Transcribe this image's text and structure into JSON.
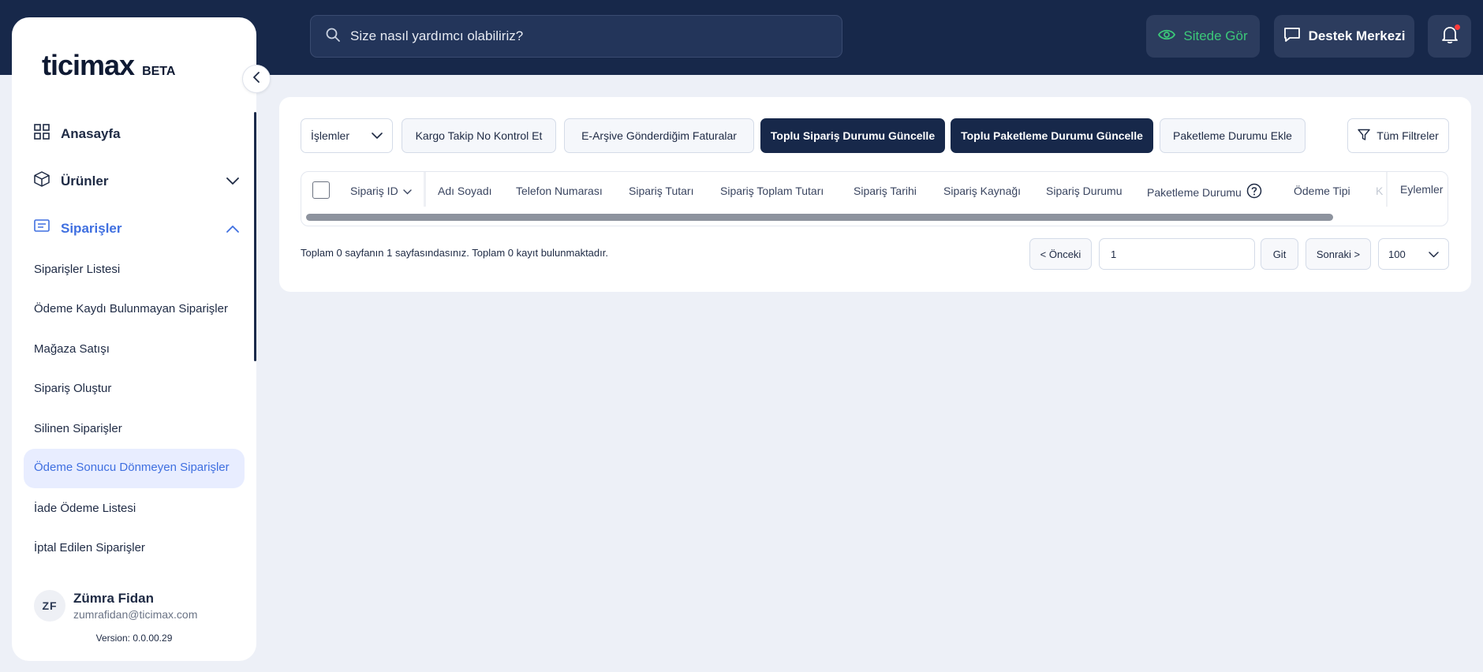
{
  "header": {
    "search_placeholder": "Size nasıl yardımcı olabiliriz?",
    "site_button": "Sitede Gör",
    "support_button": "Destek Merkezi"
  },
  "sidebar": {
    "logo_text": "ticimax",
    "logo_badge": "BETA",
    "nav": [
      {
        "label": "Anasayfa",
        "icon": "grid-icon"
      },
      {
        "label": "Ürünler",
        "icon": "box-icon"
      },
      {
        "label": "Siparişler",
        "icon": "receipt-icon"
      }
    ],
    "sub_items": [
      "Siparişler Listesi",
      "Ödeme Kaydı Bulunmayan Siparişler",
      "Mağaza Satışı",
      "Sipariş Oluştur",
      "Silinen Siparişler",
      "Ödeme Sonucu Dönmeyen Siparişler",
      "İade Ödeme Listesi",
      "İptal Edilen Siparişler"
    ],
    "selected_sub_item": "Ödeme Sonucu Dönmeyen Siparişler",
    "user": {
      "initials": "ZF",
      "name": "Zümra Fidan",
      "email": "zumrafidan@ticimax.com"
    },
    "version": "Version: 0.0.00.29"
  },
  "toolbar": {
    "actions_select": "İşlemler",
    "buttons": [
      "Kargo Takip No Kontrol Et",
      "E-Arşive Gönderdiğim Faturalar",
      "Toplu Sipariş Durumu Güncelle",
      "Toplu Paketleme Durumu Güncelle",
      "Paketleme Durumu Ekle"
    ],
    "filter_button": "Tüm Filtreler"
  },
  "table": {
    "columns": [
      "Sipariş ID",
      "Adı Soyadı",
      "Telefon Numarası",
      "Sipariş Tutarı",
      "Sipariş Toplam Tutarı",
      "Sipariş Tarihi",
      "Sipariş Kaynağı",
      "Sipariş Durumu",
      "Paketleme Durumu",
      "Ödeme Tipi",
      "K",
      "Eylemler"
    ],
    "rows": []
  },
  "pagination": {
    "summary": "Toplam 0 sayfanın 1 sayfasındasınız. Toplam 0 kayıt bulunmaktadır.",
    "prev": "< Önceki",
    "page_value": "1",
    "go": "Git",
    "next": "Sonraki >",
    "page_size": "100"
  },
  "colors": {
    "header_bg": "#17284a",
    "accent_blue": "#3f6fe0",
    "success_green": "#3cc879",
    "notification_red": "#ff3b3b"
  }
}
